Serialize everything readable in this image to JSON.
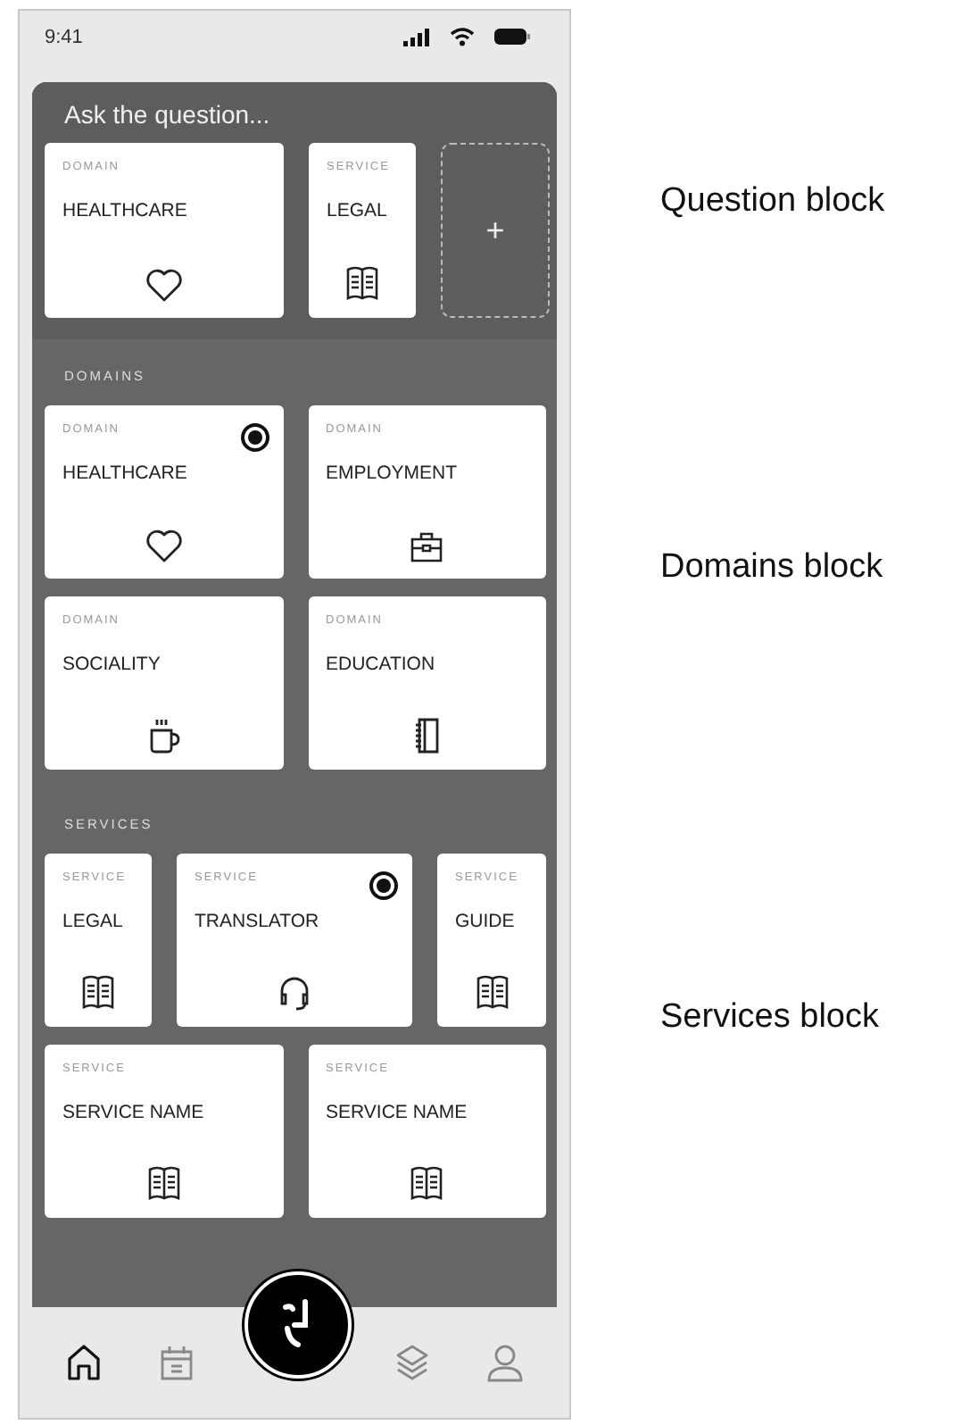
{
  "status_bar": {
    "time": "9:41"
  },
  "question": {
    "title": "Ask the question...",
    "cards": [
      {
        "type": "DOMAIN",
        "name": "HEALTHCARE",
        "kind": "heart"
      },
      {
        "type": "SERVICE",
        "name": "LEGAL",
        "kind": "book"
      }
    ],
    "add_label": "+"
  },
  "domains": {
    "title": "DOMAINS",
    "rows": [
      [
        {
          "type": "DOMAIN",
          "name": "HEALTHCARE",
          "kind": "heart",
          "selected": true
        },
        {
          "type": "DOMAIN",
          "name": "EMPLOYMENT",
          "kind": "briefcase",
          "selected": false
        }
      ],
      [
        {
          "type": "DOMAIN",
          "name": "SOCIALITY",
          "kind": "cup",
          "selected": false
        },
        {
          "type": "DOMAIN",
          "name": "EDUCATION",
          "kind": "notebook",
          "selected": false
        }
      ]
    ]
  },
  "services": {
    "title": "SERVICES",
    "rows": [
      [
        {
          "type": "SERVICE",
          "name": "LEGAL",
          "kind": "book",
          "selected": false
        },
        {
          "type": "SERVICE",
          "name": "TRANSLATOR",
          "kind": "headset",
          "selected": true
        },
        {
          "type": "SERVICE",
          "name": "GUIDE",
          "kind": "book",
          "selected": false
        }
      ],
      [
        {
          "type": "SERVICE",
          "name": "SERVICE NAME",
          "kind": "book",
          "selected": false
        },
        {
          "type": "SERVICE",
          "name": "SERVICE NAME",
          "kind": "book",
          "selected": false
        }
      ]
    ]
  },
  "nav": [
    {
      "kind": "home",
      "selected": true
    },
    {
      "kind": "calendar",
      "selected": false
    },
    {
      "kind": "layers",
      "selected": false
    },
    {
      "kind": "person",
      "selected": false
    }
  ],
  "annotations": [
    "Question block",
    "Domains block",
    "Services block"
  ]
}
